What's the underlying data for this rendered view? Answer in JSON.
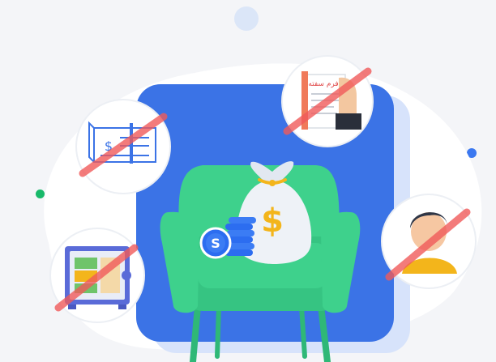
{
  "illustration": {
    "colors": {
      "background": "#f4f5f8",
      "blob": "#ffffff",
      "panel": "#3b73e6",
      "panel_shadow": "#d7e3fb",
      "armchair": "#3ed18c",
      "armchair_dark": "#2fb877",
      "money_bag": "#eef2f7",
      "coin": "#2c6df0",
      "dollar_sign": "#f3b51b",
      "strike": "#f05a5a",
      "accent_dot_blue": "#3b78f0",
      "accent_dot_green": "#19b96a"
    },
    "icons": {
      "cheque": "cheque-icon",
      "promissory_note": "promissory-note-icon",
      "safe": "safe-icon",
      "guarantor": "guarantor-person-icon",
      "money_bag": "money-bag-icon",
      "coins": "coin-stack-icon",
      "armchair": "armchair-icon"
    },
    "texts": {
      "note_title": "فرم سفته",
      "bag_symbol": "$",
      "cheque_symbol": "$",
      "coin_letter": "S"
    }
  }
}
